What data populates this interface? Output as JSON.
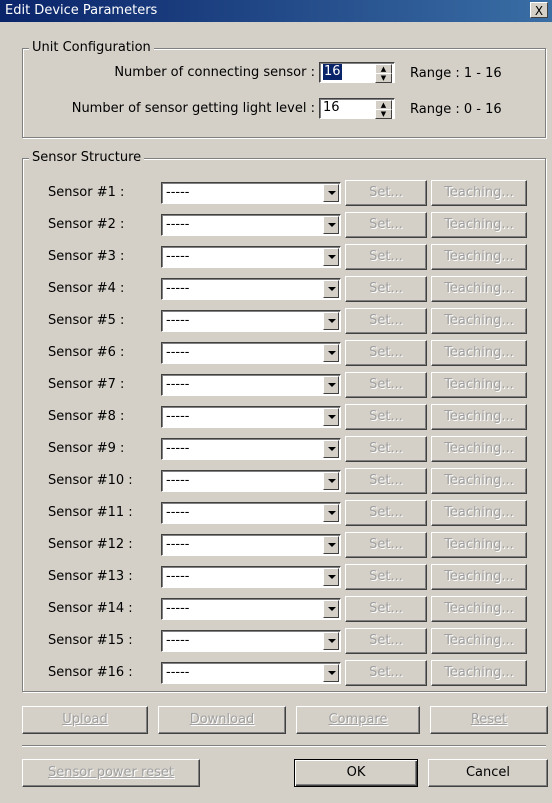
{
  "window": {
    "title": "Edit Device Parameters",
    "close_label": "X"
  },
  "unit_config": {
    "legend": "Unit Configuration",
    "connecting_label": "Number of connecting sensor :",
    "connecting_value": "16",
    "connecting_range": "Range : 1 - 16",
    "light_label": "Number of sensor getting light level :",
    "light_value": "16",
    "light_range": "Range : 0 - 16"
  },
  "sensor_structure": {
    "legend": "Sensor Structure",
    "sensors": [
      {
        "label": "Sensor #1 :",
        "value": "-----",
        "set": "Set...",
        "teaching": "Teaching..."
      },
      {
        "label": "Sensor #2 :",
        "value": "-----",
        "set": "Set...",
        "teaching": "Teaching..."
      },
      {
        "label": "Sensor #3 :",
        "value": "-----",
        "set": "Set...",
        "teaching": "Teaching..."
      },
      {
        "label": "Sensor #4 :",
        "value": "-----",
        "set": "Set...",
        "teaching": "Teaching..."
      },
      {
        "label": "Sensor #5 :",
        "value": "-----",
        "set": "Set...",
        "teaching": "Teaching..."
      },
      {
        "label": "Sensor #6 :",
        "value": "-----",
        "set": "Set...",
        "teaching": "Teaching..."
      },
      {
        "label": "Sensor #7 :",
        "value": "-----",
        "set": "Set...",
        "teaching": "Teaching..."
      },
      {
        "label": "Sensor #8 :",
        "value": "-----",
        "set": "Set...",
        "teaching": "Teaching..."
      },
      {
        "label": "Sensor #9 :",
        "value": "-----",
        "set": "Set...",
        "teaching": "Teaching..."
      },
      {
        "label": "Sensor #10 :",
        "value": "-----",
        "set": "Set...",
        "teaching": "Teaching..."
      },
      {
        "label": "Sensor #11 :",
        "value": "-----",
        "set": "Set...",
        "teaching": "Teaching..."
      },
      {
        "label": "Sensor #12 :",
        "value": "-----",
        "set": "Set...",
        "teaching": "Teaching..."
      },
      {
        "label": "Sensor #13 :",
        "value": "-----",
        "set": "Set...",
        "teaching": "Teaching..."
      },
      {
        "label": "Sensor #14 :",
        "value": "-----",
        "set": "Set...",
        "teaching": "Teaching..."
      },
      {
        "label": "Sensor #15 :",
        "value": "-----",
        "set": "Set...",
        "teaching": "Teaching..."
      },
      {
        "label": "Sensor #16 :",
        "value": "-----",
        "set": "Set...",
        "teaching": "Teaching..."
      }
    ]
  },
  "actions": {
    "upload": "Upload",
    "download": "Download",
    "compare": "Compare",
    "reset": "Reset"
  },
  "footer": {
    "power_reset": "Sensor power reset",
    "ok": "OK",
    "cancel": "Cancel"
  }
}
